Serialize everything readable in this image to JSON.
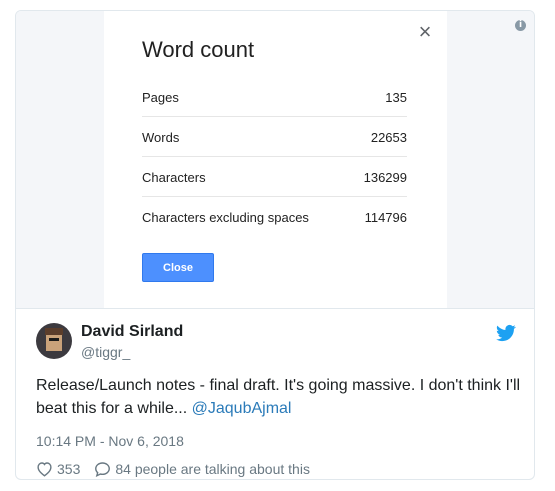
{
  "dialog": {
    "title": "Word count",
    "close_glyph": "×",
    "stats": [
      {
        "label": "Pages",
        "value": "135"
      },
      {
        "label": "Words",
        "value": "22653"
      },
      {
        "label": "Characters",
        "value": "136299"
      },
      {
        "label": "Characters excluding spaces",
        "value": "114796"
      }
    ],
    "close_button_label": "Close"
  },
  "info_icon": {
    "icon": "info-icon",
    "glyph": "i"
  },
  "tweet": {
    "name": "David Sirland",
    "handle": "@tiggr_",
    "text": "Release/Launch notes - final draft. It's going massive. I don't think I'll beat this for a while... ",
    "mention": "@JaqubAjmal",
    "timestamp": "10:14 PM - Nov 6, 2018",
    "likes": "353",
    "replies_text": "84 people are talking about this",
    "bird_icon": "twitter-bird-icon",
    "accent": "#1da1f2",
    "link_color": "#2b7bb9"
  }
}
